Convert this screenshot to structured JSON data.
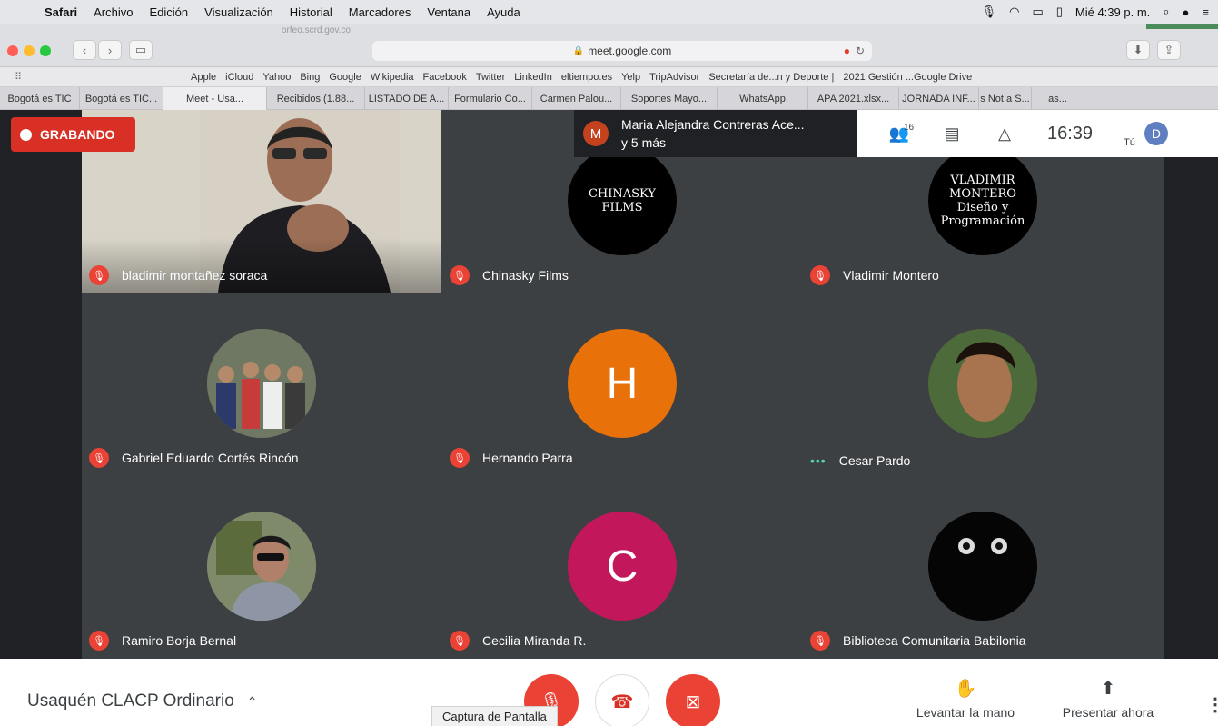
{
  "menubar": {
    "app": "Safari",
    "items": [
      "Archivo",
      "Edición",
      "Visualización",
      "Historial",
      "Marcadores",
      "Ventana",
      "Ayuda"
    ],
    "clock": "Mié 4:39 p. m."
  },
  "browser": {
    "ghost_title": "orfeo.scrd.gov.co",
    "url": "meet.google.com"
  },
  "favorites": [
    "Apple",
    "iCloud",
    "Yahoo",
    "Bing",
    "Google",
    "Wikipedia",
    "Facebook",
    "Twitter",
    "LinkedIn",
    "eltiempo.es",
    "Yelp",
    "TripAdvisor",
    "Secretaría de...n y Deporte |",
    "2021 Gestión ...Google Drive"
  ],
  "tabs": [
    "Bogotá es TIC",
    "Bogotá es TIC...",
    "Meet - Usa...",
    "Recibidos (1.88...",
    "LISTADO DE A...",
    "Formulario Co...",
    "Carmen Palou...",
    "Soportes Mayo...",
    "WhatsApp",
    "APA 2021.xlsx...",
    "JORNADA INF...",
    "s Not a S...",
    "as..."
  ],
  "recording": {
    "label": "GRABANDO"
  },
  "presenting": {
    "initial": "M",
    "line1": "Maria Alejandra Contreras Ace...",
    "line2": "y 5 más"
  },
  "meet_topbar": {
    "participants_count": "16",
    "clock": "16:39",
    "self_label": "Tú",
    "self_initial": "D"
  },
  "participants": [
    {
      "name": "bladimir montañez soraca",
      "type": "video",
      "muted": true
    },
    {
      "name": "Chinasky Films",
      "type": "logo",
      "logo_text": "CHINASKY FILMS",
      "muted": true
    },
    {
      "name": "Vladimir Montero",
      "type": "logo",
      "logo_text": "VLADIMIR MONTERO Diseño y Programación",
      "muted": true
    },
    {
      "name": "Gabriel Eduardo Cortés Rincón",
      "type": "photo",
      "muted": true
    },
    {
      "name": "Hernando Parra",
      "type": "initial",
      "initial": "H",
      "color": "#e8710a",
      "muted": true
    },
    {
      "name": "Cesar Pardo",
      "type": "photo",
      "muted": false
    },
    {
      "name": "Ramiro Borja Bernal",
      "type": "photo",
      "muted": true
    },
    {
      "name": "Cecilia Miranda R.",
      "type": "initial",
      "initial": "C",
      "color": "#c2185b",
      "muted": true
    },
    {
      "name": "Biblioteca Comunitaria Babilonia",
      "type": "photo",
      "muted": true
    }
  ],
  "bottombar": {
    "meeting_name": "Usaquén CLACP Ordinario",
    "tooltip": "Captura de Pantalla",
    "raise_hand": "Levantar la mano",
    "present_now": "Presentar ahora"
  }
}
